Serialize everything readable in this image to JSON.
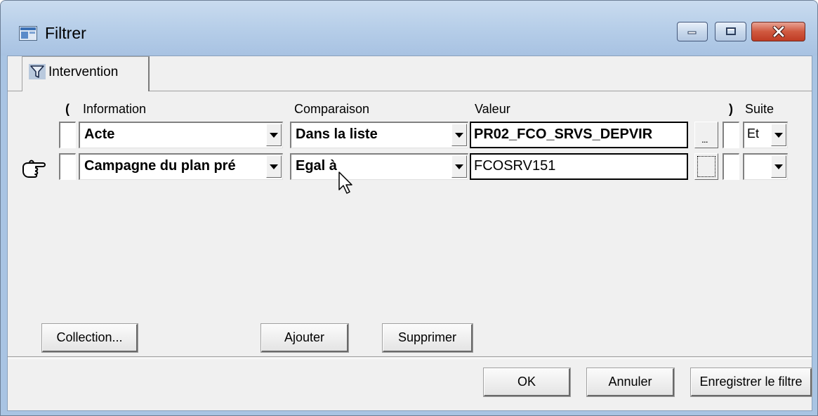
{
  "window": {
    "title": "Filtrer",
    "colors": {
      "titlebar": "#b5cde8",
      "close": "#c8452c",
      "client": "#f0f0f0"
    }
  },
  "tab": {
    "label": "Intervention",
    "icon": "filter-funnel-icon"
  },
  "headers": {
    "open_paren": "(",
    "information": "Information",
    "comparaison": "Comparaison",
    "valeur": "Valeur",
    "close_paren": ")",
    "suite": "Suite"
  },
  "rows": [
    {
      "information": "Acte",
      "comparaison": "Dans la liste",
      "valeur": "PR02_FCO_SRVS_DEPVIR",
      "dots": "...",
      "suite": "Et"
    },
    {
      "information": "Campagne du plan pré",
      "comparaison": "Egal à",
      "valeur": "FCOSRV151",
      "dots": "",
      "suite": ""
    }
  ],
  "buttons": {
    "collection": "Collection...",
    "ajouter": "Ajouter",
    "supprimer": "Supprimer",
    "ok": "OK",
    "annuler": "Annuler",
    "enregistrer": "Enregistrer le filtre"
  },
  "icons": [
    "app-window-icon",
    "pointing-hand-icon",
    "mouse-cursor-icon"
  ]
}
